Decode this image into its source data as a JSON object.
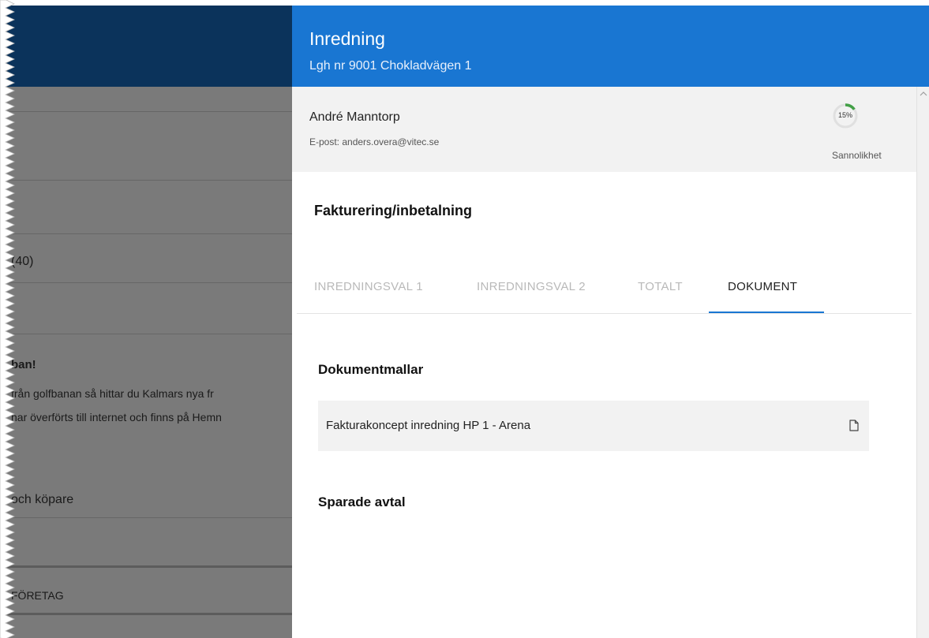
{
  "background_page": {
    "texts": [
      "(40)",
      "ban!",
      "från golfbanan så hittar du Kalmars nya fr",
      "har överförts till internet och finns på Hemn",
      "och köpare",
      "FÖRETAG"
    ]
  },
  "drawer": {
    "title": "Inredning",
    "subtitle": "Lgh nr 9001 Chokladvägen 1",
    "contact": {
      "name": "André Manntorp",
      "email": "E-post: anders.overa@vitec.se",
      "probability_value": "15%",
      "probability_fraction": 0.15,
      "probability_label": "Sannolikhet"
    },
    "section_title": "Fakturering/inbetalning",
    "tabs": [
      {
        "label": "INREDNINGSVAL 1",
        "active": false
      },
      {
        "label": "INREDNINGSVAL 2",
        "active": false
      },
      {
        "label": "TOTALT",
        "active": false
      },
      {
        "label": "DOKUMENT",
        "active": true
      }
    ],
    "document_templates": {
      "title": "Dokumentmallar",
      "items": [
        {
          "label": "Fakturakoncept inredning HP 1 - Arena",
          "icon": "document-icon"
        }
      ]
    },
    "saved_agreements": {
      "title": "Sparade avtal"
    }
  },
  "colors": {
    "header_blue": "#1976d2",
    "background_header": "#0b335b",
    "overlay_gray": "#7a7a7a",
    "progress_green": "#43a047"
  }
}
